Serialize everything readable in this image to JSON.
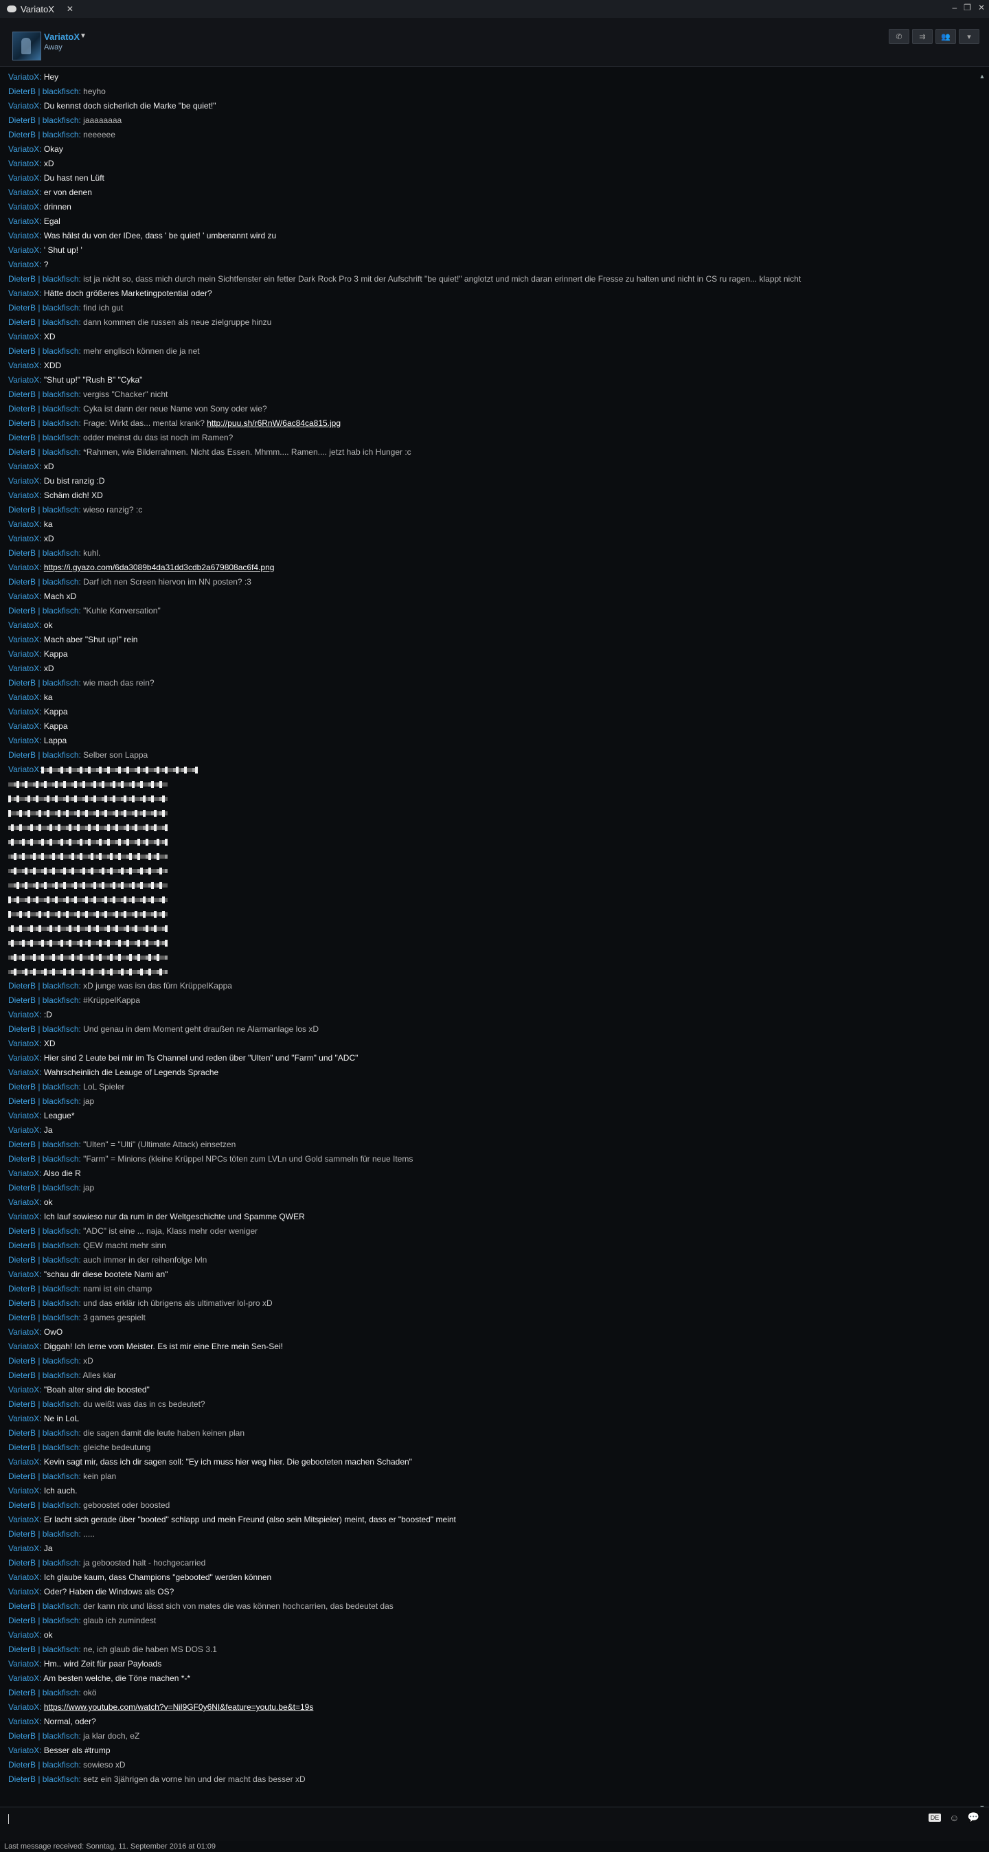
{
  "window": {
    "tab_title": "VariatoX",
    "tab_close": "✕",
    "minimize": "–",
    "restore": "❐",
    "close": "✕"
  },
  "header": {
    "username": "VariatoX",
    "status": "Away",
    "caret": "▼",
    "tools": [
      "✆",
      "⇉",
      "👥",
      "▾"
    ]
  },
  "messages": [
    {
      "s": "VariatoX",
      "t": "Hey"
    },
    {
      "s": "DieterB | blackfisch",
      "t": "heyho"
    },
    {
      "s": "VariatoX",
      "t": "Du kennst doch sicherlich die Marke \"be quiet!\""
    },
    {
      "s": "DieterB | blackfisch",
      "t": "jaaaaaaaa"
    },
    {
      "s": "DieterB | blackfisch",
      "t": "neeeeee"
    },
    {
      "s": "VariatoX",
      "t": "Okay"
    },
    {
      "s": "VariatoX",
      "t": "xD"
    },
    {
      "s": "VariatoX",
      "t": "Du hast nen Lüft"
    },
    {
      "s": "VariatoX",
      "t": "er von denen"
    },
    {
      "s": "VariatoX",
      "t": "drinnen"
    },
    {
      "s": "VariatoX",
      "t": "Egal"
    },
    {
      "s": "VariatoX",
      "t": "Was hälst du von der IDee, dass ' be quiet! ' umbenannt wird zu"
    },
    {
      "s": "VariatoX",
      "t": "' Shut up! '"
    },
    {
      "s": "VariatoX",
      "t": "?"
    },
    {
      "s": "DieterB | blackfisch",
      "t": "ist ja nicht so, dass mich durch mein Sichtfenster ein fetter Dark Rock Pro 3 mit der Aufschrift \"be quiet!\" anglotzt und mich daran erinnert die Fresse zu halten und nicht in CS ru ragen... klappt nicht"
    },
    {
      "s": "VariatoX",
      "t": "Hätte doch größeres Marketingpotential oder?"
    },
    {
      "s": "DieterB | blackfisch",
      "t": "find ich gut"
    },
    {
      "s": "DieterB | blackfisch",
      "t": "dann kommen die russen als neue zielgruppe hinzu"
    },
    {
      "s": "VariatoX",
      "t": "XD"
    },
    {
      "s": "DieterB | blackfisch",
      "t": "mehr englisch können die ja net"
    },
    {
      "s": "VariatoX",
      "t": "XDD"
    },
    {
      "s": "VariatoX",
      "t": "\"Shut up!\" \"Rush B\" \"Cyka\""
    },
    {
      "s": "DieterB | blackfisch",
      "t": "vergiss \"Chacker\" nicht"
    },
    {
      "s": "DieterB | blackfisch",
      "t": "Cyka ist dann der neue Name von Sony oder wie?"
    },
    {
      "s": "DieterB | blackfisch",
      "t": "Frage: Wirkt das... mental krank? ",
      "l": "http://puu.sh/r6RnW/6ac84ca815.jpg"
    },
    {
      "s": "DieterB | blackfisch",
      "t": "odder meinst du das ist noch im Ramen?"
    },
    {
      "s": "DieterB | blackfisch",
      "t": "*Rahmen, wie Bilderrahmen. Nicht das Essen. Mhmm.... Ramen.... jetzt hab ich Hunger :c"
    },
    {
      "s": "VariatoX",
      "t": "xD"
    },
    {
      "s": "VariatoX",
      "t": "Du bist ranzig :D"
    },
    {
      "s": "VariatoX",
      "t": "Schäm dich! XD"
    },
    {
      "s": "DieterB | blackfisch",
      "t": "wieso ranzig? :c"
    },
    {
      "s": "VariatoX",
      "t": "ka"
    },
    {
      "s": "VariatoX",
      "t": "xD"
    },
    {
      "s": "DieterB | blackfisch",
      "t": "kuhl."
    },
    {
      "s": "VariatoX",
      "t": "",
      "l": "https://i.gyazo.com/6da3089b4da31dd3cdb2a679808ac6f4.png"
    },
    {
      "s": "DieterB | blackfisch",
      "t": "Darf ich nen Screen hiervon im NN posten? :3"
    },
    {
      "s": "VariatoX",
      "t": "Mach xD"
    },
    {
      "s": "DieterB | blackfisch",
      "t": "\"Kuhle Konversation\""
    },
    {
      "s": "VariatoX",
      "t": "ok"
    },
    {
      "s": "VariatoX",
      "t": "Mach aber \"Shut up!\" rein"
    },
    {
      "s": "VariatoX",
      "t": "Kappa"
    },
    {
      "s": "VariatoX",
      "t": "xD"
    },
    {
      "s": "DieterB | blackfisch",
      "t": "wie mach das rein?"
    },
    {
      "s": "VariatoX",
      "t": "ka"
    },
    {
      "s": "VariatoX",
      "t": "Kappa"
    },
    {
      "s": "VariatoX",
      "t": "Kappa"
    },
    {
      "s": "VariatoX",
      "t": "Lappa"
    },
    {
      "s": "DieterB | blackfisch",
      "t": "Selber son Lappa"
    },
    {
      "s": "VariatoX",
      "t": "",
      "art": true
    },
    {
      "art_line": true
    },
    {
      "art_line": true
    },
    {
      "art_line": true
    },
    {
      "art_line": true
    },
    {
      "art_line": true
    },
    {
      "art_line": true
    },
    {
      "art_line": true
    },
    {
      "art_line": true
    },
    {
      "art_line": true
    },
    {
      "art_line": true
    },
    {
      "art_line": true
    },
    {
      "art_line": true
    },
    {
      "art_line": true
    },
    {
      "art_line": true
    },
    {
      "s": "DieterB | blackfisch",
      "t": "xD junge was isn das fürn KrüppelKappa"
    },
    {
      "s": "DieterB | blackfisch",
      "t": "#KrüppelKappa"
    },
    {
      "s": "VariatoX",
      "t": ":D"
    },
    {
      "s": "DieterB | blackfisch",
      "t": "Und genau in dem Moment geht draußen ne Alarmanlage los xD"
    },
    {
      "s": "VariatoX",
      "t": "XD"
    },
    {
      "s": "VariatoX",
      "t": "Hier sind 2 Leute bei mir im Ts Channel und reden über \"Ulten\" und \"Farm\" und \"ADC\""
    },
    {
      "s": "VariatoX",
      "t": "Wahrscheinlich die Leauge of Legends Sprache"
    },
    {
      "s": "DieterB | blackfisch",
      "t": "LoL Spieler"
    },
    {
      "s": "DieterB | blackfisch",
      "t": "jap"
    },
    {
      "s": "VariatoX",
      "t": "League*"
    },
    {
      "s": "VariatoX",
      "t": "Ja"
    },
    {
      "s": "DieterB | blackfisch",
      "t": "\"Ulten\" = \"Ulti\" (Ultimate Attack) einsetzen"
    },
    {
      "s": "DieterB | blackfisch",
      "t": "\"Farm\" = Minions (kleine Krüppel NPCs töten zum LVLn und Gold sammeln für neue Items"
    },
    {
      "s": "VariatoX",
      "t": "Also die R"
    },
    {
      "s": "DieterB | blackfisch",
      "t": "jap"
    },
    {
      "s": "VariatoX",
      "t": "ok"
    },
    {
      "s": "VariatoX",
      "t": "Ich lauf sowieso nur da rum in der Weltgeschichte und Spamme QWER"
    },
    {
      "s": "DieterB | blackfisch",
      "t": "\"ADC\" ist eine ... naja, Klass mehr oder weniger"
    },
    {
      "s": "DieterB | blackfisch",
      "t": "QEW macht mehr sinn"
    },
    {
      "s": "DieterB | blackfisch",
      "t": "auch immer in der reihenfolge lvln"
    },
    {
      "s": "VariatoX",
      "t": "\"schau dir diese bootete Nami an\""
    },
    {
      "s": "DieterB | blackfisch",
      "t": "nami ist ein champ"
    },
    {
      "s": "DieterB | blackfisch",
      "t": "und das erklär ich übrigens als ultimativer lol-pro xD"
    },
    {
      "s": "DieterB | blackfisch",
      "t": "3 games gespielt"
    },
    {
      "s": "VariatoX",
      "t": "OwO"
    },
    {
      "s": "VariatoX",
      "t": "Diggah! Ich lerne vom Meister. Es ist mir eine Ehre mein Sen-Sei!"
    },
    {
      "s": "DieterB | blackfisch",
      "t": "xD"
    },
    {
      "s": "DieterB | blackfisch",
      "t": "Alles klar"
    },
    {
      "s": "VariatoX",
      "t": "\"Boah alter sind die boosted\""
    },
    {
      "s": "DieterB | blackfisch",
      "t": "du weißt was das in cs bedeutet?"
    },
    {
      "s": "VariatoX",
      "t": "Ne in LoL"
    },
    {
      "s": "DieterB | blackfisch",
      "t": "die sagen damit die leute haben keinen plan"
    },
    {
      "s": "DieterB | blackfisch",
      "t": "gleiche bedeutung"
    },
    {
      "s": "VariatoX",
      "t": "Kevin sagt mir, dass ich dir sagen soll: \"Ey ich muss hier weg hier. Die gebooteten machen Schaden\""
    },
    {
      "s": "DieterB | blackfisch",
      "t": "kein plan"
    },
    {
      "s": "VariatoX",
      "t": "Ich auch."
    },
    {
      "s": "DieterB | blackfisch",
      "t": "geboostet oder boosted"
    },
    {
      "s": "VariatoX",
      "t": "Er lacht sich gerade über \"booted\" schlapp und mein Freund (also sein Mitspieler) meint, dass er \"boosted\" meint"
    },
    {
      "s": "DieterB | blackfisch",
      "t": "....."
    },
    {
      "s": "VariatoX",
      "t": "Ja"
    },
    {
      "s": "DieterB | blackfisch",
      "t": "ja geboosted halt - hochgecarried"
    },
    {
      "s": "VariatoX",
      "t": "Ich glaube kaum, dass Champions \"gebooted\" werden können"
    },
    {
      "s": "VariatoX",
      "t": "Oder? Haben die Windows als OS?"
    },
    {
      "s": "DieterB | blackfisch",
      "t": "der kann nix und lässt sich von mates die was können hochcarrien, das bedeutet das"
    },
    {
      "s": "DieterB | blackfisch",
      "t": "glaub ich zumindest"
    },
    {
      "s": "VariatoX",
      "t": "ok"
    },
    {
      "s": "DieterB | blackfisch",
      "t": "ne, ich glaub die haben MS DOS 3.1"
    },
    {
      "s": "VariatoX",
      "t": "Hm.. wird Zeit für paar Payloads"
    },
    {
      "s": "VariatoX",
      "t": "Am besten welche, die Töne machen *-*"
    },
    {
      "s": "DieterB | blackfisch",
      "t": "okö"
    },
    {
      "s": "VariatoX",
      "t": "",
      "l": "https://www.youtube.com/watch?v=Nil9GF0y6NI&feature=youtu.be&t=19s"
    },
    {
      "s": "VariatoX",
      "t": "Normal, oder?"
    },
    {
      "s": "DieterB | blackfisch",
      "t": "ja klar doch, eZ"
    },
    {
      "s": "VariatoX",
      "t": "Besser als #trump"
    },
    {
      "s": "DieterB | blackfisch",
      "t": "sowieso xD"
    },
    {
      "s": "DieterB | blackfisch",
      "t": "setz ein 3jährigen da vorne hin und der macht das besser xD"
    }
  ],
  "input": {
    "value": "",
    "lang_badge": "DE",
    "emoji_icon": "☺",
    "send_icon": "💬"
  },
  "statusbar": {
    "text": "Last message received: Sonntag, 11. September 2016 at 01:09"
  },
  "colors": {
    "sender": "#3fa0e0",
    "bg": "#0b0d10"
  }
}
